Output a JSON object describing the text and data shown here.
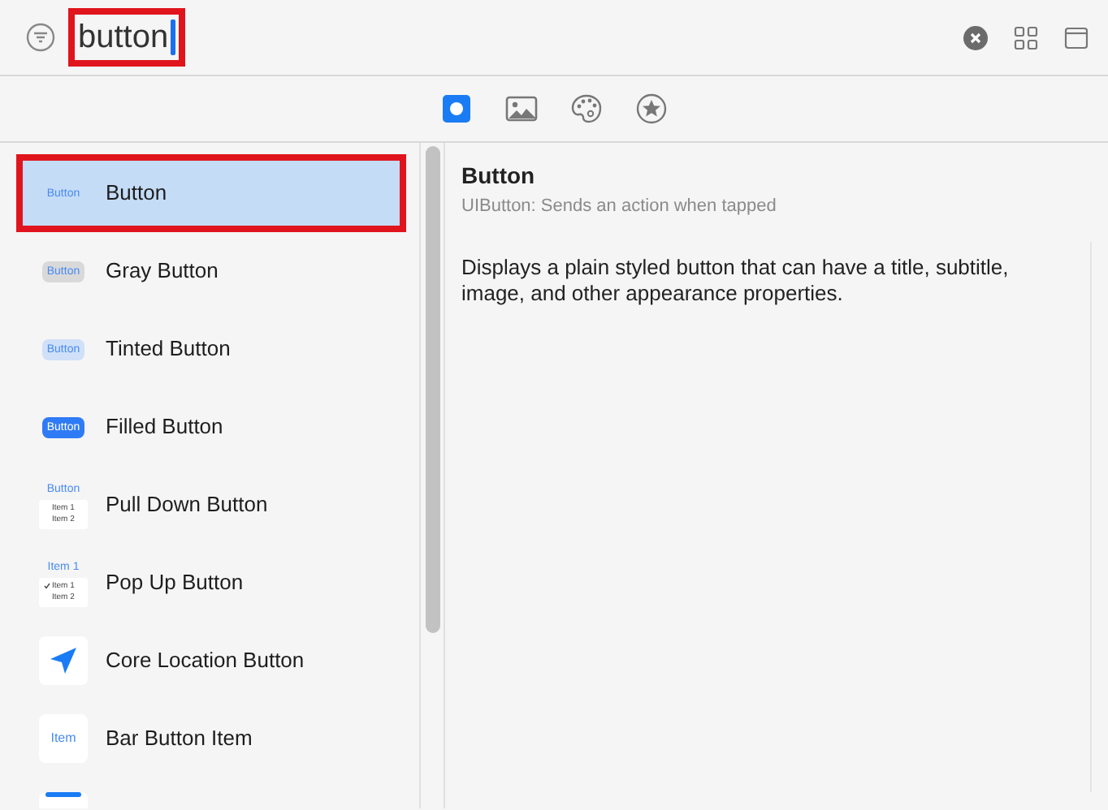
{
  "search": {
    "value": "button",
    "highlighted": true
  },
  "filter_tabs": [
    {
      "kind": "object",
      "selected": true
    },
    {
      "kind": "image",
      "selected": false
    },
    {
      "kind": "color",
      "selected": false
    },
    {
      "kind": "symbol",
      "selected": false
    }
  ],
  "items": [
    {
      "name": "Button",
      "selected": true,
      "highlighted": true,
      "preview": {
        "kind": "plain",
        "label": "Button"
      }
    },
    {
      "name": "Gray Button",
      "selected": false,
      "highlighted": false,
      "preview": {
        "kind": "gray",
        "label": "Button"
      }
    },
    {
      "name": "Tinted Button",
      "selected": false,
      "highlighted": false,
      "preview": {
        "kind": "tinted",
        "label": "Button"
      }
    },
    {
      "name": "Filled Button",
      "selected": false,
      "highlighted": false,
      "preview": {
        "kind": "filled",
        "label": "Button"
      }
    },
    {
      "name": "Pull Down Button",
      "selected": false,
      "highlighted": false,
      "preview": {
        "kind": "menu",
        "label": "Button",
        "menu_items": [
          {
            "text": "Item 1",
            "checked": false
          },
          {
            "text": "Item 2",
            "checked": false
          }
        ]
      }
    },
    {
      "name": "Pop Up Button",
      "selected": false,
      "highlighted": false,
      "preview": {
        "kind": "menu",
        "label": "Item 1",
        "menu_items": [
          {
            "text": "Item 1",
            "checked": true
          },
          {
            "text": "Item 2",
            "checked": false
          }
        ]
      }
    },
    {
      "name": "Core Location Button",
      "selected": false,
      "highlighted": false,
      "preview": {
        "kind": "location"
      }
    },
    {
      "name": "Bar Button Item",
      "selected": false,
      "highlighted": false,
      "preview": {
        "kind": "bar-item",
        "label": "Item"
      }
    },
    {
      "preview": {
        "kind": "partial"
      }
    }
  ],
  "detail": {
    "title": "Button",
    "subtitle": "UIButton: Sends an action when tapped",
    "description": "Displays a plain styled button that can have a title, subtitle, image, and other appearance properties."
  }
}
